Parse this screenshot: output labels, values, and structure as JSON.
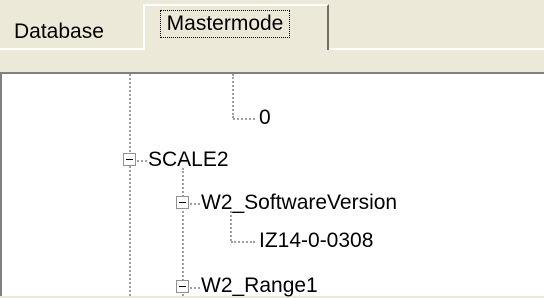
{
  "tabs": [
    {
      "label": "Database"
    },
    {
      "label": "Mastermode"
    }
  ],
  "tree": {
    "nodes": [
      {
        "label": "0"
      },
      {
        "label": "SCALE2"
      },
      {
        "label": "W2_SoftwareVersion"
      },
      {
        "label": "IZ14-0-0308"
      },
      {
        "label": "W2_Range1"
      }
    ]
  }
}
